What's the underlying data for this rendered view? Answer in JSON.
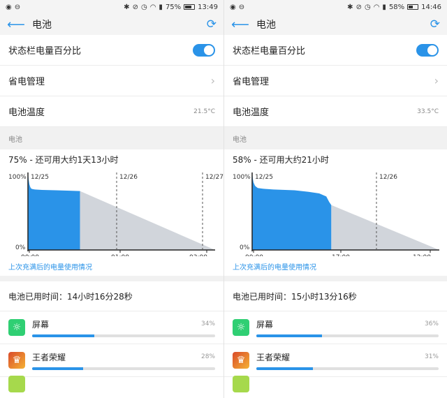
{
  "panels": [
    {
      "status": {
        "battery_pct": "75%",
        "time": "13:49"
      },
      "title": "电池",
      "settings": [
        {
          "label": "状态栏电量百分比"
        },
        {
          "label": "省电管理"
        },
        {
          "label": "电池温度",
          "value": "21.5°C"
        }
      ],
      "section_header": "电池",
      "summary": "75% - 还可用大约1天13小时",
      "chart_data": {
        "type": "area",
        "y_tick_labels": [
          "100%",
          "0%"
        ],
        "date_labels": [
          "12/25",
          "12/26",
          "12/27"
        ],
        "x_tick_labels": [
          "00:00",
          "01:00",
          "03:00"
        ],
        "used_series": [
          [
            0,
            100
          ],
          [
            1,
            91
          ],
          [
            2,
            85
          ],
          [
            3,
            82
          ],
          [
            4,
            80
          ],
          [
            5,
            79
          ],
          [
            7,
            78.5
          ],
          [
            10,
            78
          ],
          [
            20,
            77.5
          ],
          [
            40,
            77
          ],
          [
            60,
            76.5
          ],
          [
            74.5,
            76
          ]
        ],
        "predicted_from": [
          74.5,
          76
        ],
        "predicted_to": [
          268,
          0
        ],
        "total_span": 268
      },
      "history_link": "上次充满后的电量使用情况",
      "used_time": "电池已用时间：14小时16分28秒",
      "apps": [
        {
          "name": "屏幕",
          "pct": "34%",
          "value": 34,
          "icon": "screen-icon"
        },
        {
          "name": "王者荣耀",
          "pct": "28%",
          "value": 28,
          "icon": "game-icon"
        }
      ],
      "battery_level": 0.75
    },
    {
      "status": {
        "battery_pct": "58%",
        "time": "14:46"
      },
      "title": "电池",
      "settings": [
        {
          "label": "状态栏电量百分比"
        },
        {
          "label": "省电管理"
        },
        {
          "label": "电池温度",
          "value": "33.5°C"
        }
      ],
      "section_header": "电池",
      "summary": "58% - 还可用大约21小时",
      "chart_data": {
        "type": "area",
        "y_tick_labels": [
          "100%",
          "0%"
        ],
        "date_labels": [
          "12/25",
          "12/26"
        ],
        "x_tick_labels": [
          "00:00",
          "17:00",
          "12:00"
        ],
        "used_series": [
          [
            0,
            100
          ],
          [
            1,
            92
          ],
          [
            2,
            87
          ],
          [
            3,
            85
          ],
          [
            4,
            83
          ],
          [
            5,
            82
          ],
          [
            8,
            80
          ],
          [
            15,
            79
          ],
          [
            30,
            78
          ],
          [
            60,
            77
          ],
          [
            80,
            75
          ],
          [
            95,
            73
          ],
          [
            105,
            69
          ],
          [
            109,
            62
          ],
          [
            112,
            58
          ]
        ],
        "predicted_from": [
          112,
          58
        ],
        "predicted_to": [
          265,
          0
        ],
        "total_span": 265
      },
      "history_link": "上次充满后的电量使用情况",
      "used_time": "电池已用时间：15小时13分16秒",
      "apps": [
        {
          "name": "屏幕",
          "pct": "36%",
          "value": 36,
          "icon": "screen-icon"
        },
        {
          "name": "王者荣耀",
          "pct": "31%",
          "value": 31,
          "icon": "game-icon"
        }
      ],
      "battery_level": 0.58
    }
  ],
  "colors": {
    "accent": "#2a93e8",
    "predicted": "#d1d5db",
    "section_bg": "#f1f1f1"
  }
}
